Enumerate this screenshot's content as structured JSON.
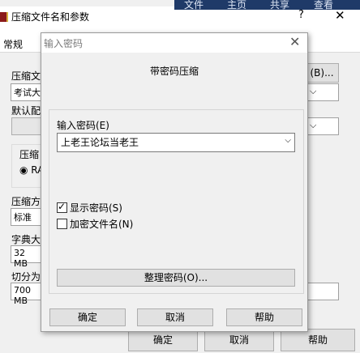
{
  "ribbon": {
    "tabs": [
      "文件",
      "主页",
      "共享",
      "查看"
    ]
  },
  "back_window": {
    "title": "压缩文件名和参数",
    "help_glyph": "?",
    "close_glyph": "✕",
    "tab_general": "常规",
    "label_archive_name": "压缩文",
    "archive_name_value": "考试大",
    "browse_button": "(B)...",
    "label_default_profile": "默认配",
    "label_format": "压缩",
    "format_option": "RA",
    "label_method": "压缩方",
    "method_value": "标准",
    "label_dict": "字典大",
    "dict_value": "32 MB",
    "label_split": "切分为",
    "split_value": "700 MB",
    "ok_button": "确定",
    "cancel_button": "取消",
    "help_button": "帮助"
  },
  "dialog": {
    "title": "输入密码",
    "close_glyph": "✕",
    "heading": "带密码压缩",
    "password_label": "输入密码(E)",
    "password_value": "上老王论坛当老王",
    "show_password_label": "显示密码(S)",
    "show_password_checked": true,
    "encrypt_filenames_label": "加密文件名(N)",
    "encrypt_filenames_checked": false,
    "organize_button": "整理密码(O)...",
    "ok_button": "确定",
    "cancel_button": "取消",
    "help_button": "帮助"
  }
}
